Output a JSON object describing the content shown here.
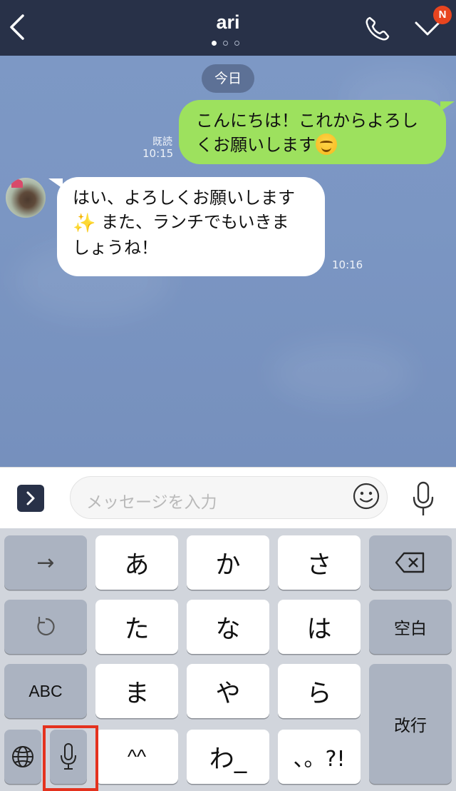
{
  "header": {
    "title": "ari",
    "page_dots": 3,
    "active_dot": 0,
    "notification_badge": "N",
    "icons": {
      "back": "chevron-left-icon",
      "call": "phone-icon",
      "menu": "chevron-down-icon"
    }
  },
  "chat": {
    "date_label": "今日",
    "messages": [
      {
        "direction": "outgoing",
        "lines": [
          "こんにちは！これからよろし",
          "くお願いします"
        ],
        "emoji": "smiling-face-icon",
        "read_label": "既読",
        "time": "10:15"
      },
      {
        "direction": "incoming",
        "lines": [
          "はい、よろしくお願いします",
          "また、ランチでもいきま",
          "しょうね！"
        ],
        "emoji": "sparkles-icon",
        "time": "10:16"
      }
    ]
  },
  "input": {
    "placeholder": "メッセージを入力",
    "icons": {
      "expand": "chevron-right-icon",
      "emoji": "smiley-icon",
      "voice": "microphone-icon"
    }
  },
  "keyboard": {
    "row1": {
      "left": "→",
      "keys": [
        "あ",
        "か",
        "さ"
      ],
      "right": "delete-icon"
    },
    "row2": {
      "left": "undo-icon",
      "keys": [
        "た",
        "な",
        "は"
      ],
      "right": "空白"
    },
    "row3": {
      "left": "ABC",
      "keys": [
        "ま",
        "や",
        "ら"
      ],
      "right": "改行"
    },
    "row4": {
      "left": "globe-icon",
      "left2": "microphone-icon",
      "keys": [
        "^^",
        "わ_",
        "、。?!"
      ]
    }
  },
  "colors": {
    "header_bg": "#283148",
    "chat_bg": "#7b96c3",
    "outgoing_bubble": "#9de15e",
    "incoming_bubble": "#ffffff",
    "badge": "#e8451f",
    "highlight_box": "#e4321e"
  }
}
